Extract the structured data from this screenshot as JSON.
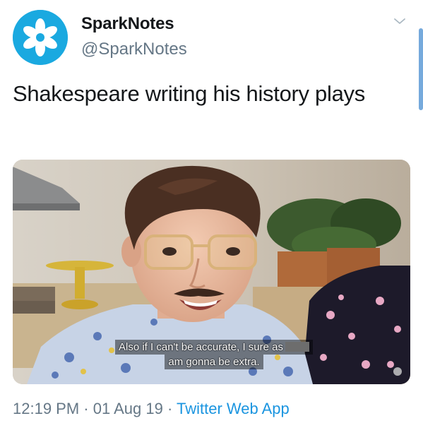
{
  "author": {
    "display_name": "SparkNotes",
    "handle": "@SparkNotes",
    "avatar_icon": "sparknotes-flower-logo",
    "brand_color": "#1aa9e0"
  },
  "tweet": {
    "text": "Shakespeare writing his history plays"
  },
  "media": {
    "subtitle_line1": "Also if I can't be accurate, I sure as",
    "subtitle_line2": "am gonna be extra."
  },
  "footer": {
    "time": "12:19 PM",
    "sep1": " · ",
    "date": "01 Aug 19",
    "sep2": " · ",
    "source": "Twitter Web App",
    "source_color": "#1b95e0"
  },
  "icons": {
    "menu": "chevron-down-icon"
  }
}
